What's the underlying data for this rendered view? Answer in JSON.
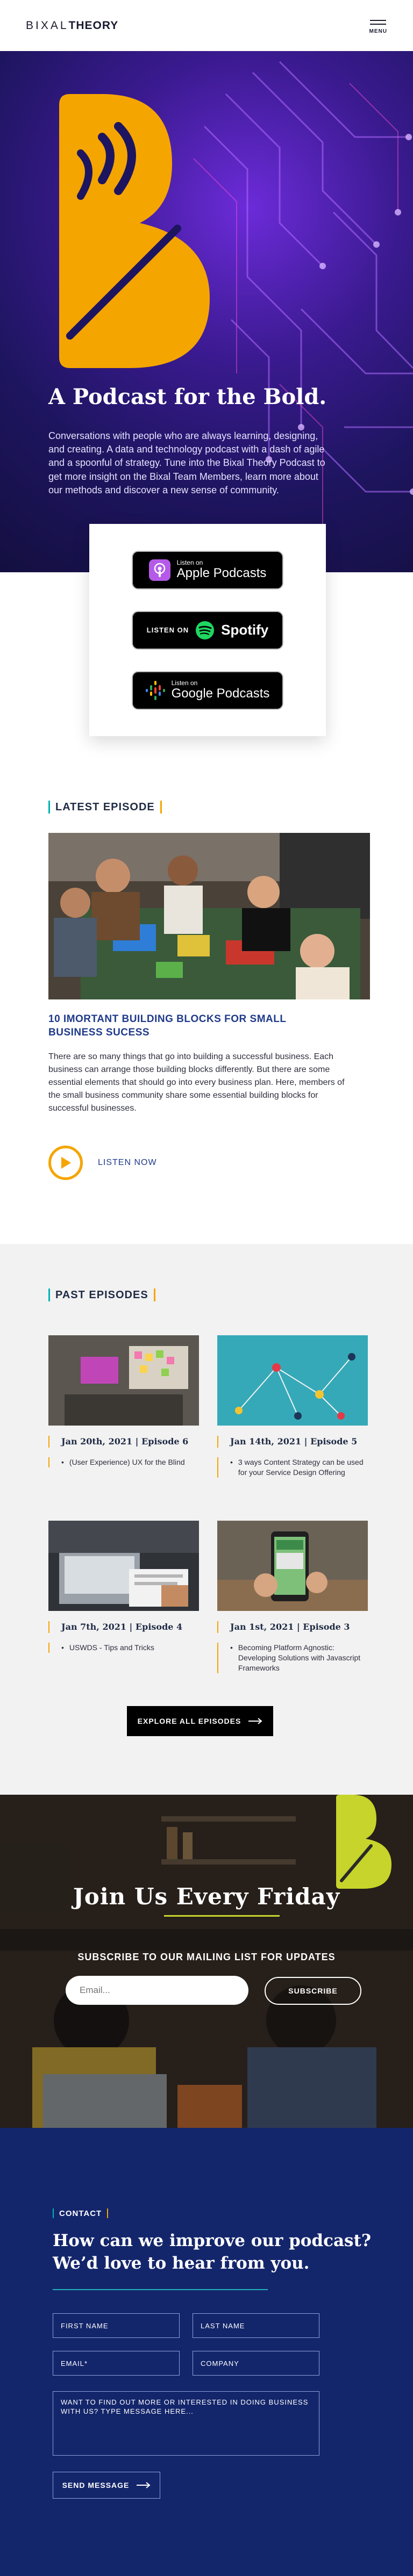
{
  "header": {
    "logo_light": "BIXAL",
    "logo_bold": "THEORY",
    "menu_label": "MENU"
  },
  "hero": {
    "title": "A Podcast for the Bold.",
    "text": "Conversations with people who are always learning, designing, and creating. A data and technology podcast with a dash of agile and a spoonful of strategy. Tune into the Bixal Theory Podcast to get more insight on the Bixal Team Members, learn more about our methods and discover a new sense of community."
  },
  "platforms": {
    "apple": {
      "small": "Listen on",
      "big": "Apple Podcasts"
    },
    "spotify": {
      "small": "LISTEN ON",
      "big": "Spotify"
    },
    "google": {
      "small": "Listen on",
      "big": "Google Podcasts"
    }
  },
  "latest": {
    "heading": "LATEST EPISODE",
    "title": "10 IMORTANT BUILDING BLOCKS FOR SMALL BUSINESS SUCESS",
    "description": "There are so many things that go into building a successful business. Each business can arrange those building blocks differently. But there are some essential elements that should go into every business plan. Here, members of the small business community share some essential building blocks for successful businesses.",
    "listen_label": "LISTEN NOW"
  },
  "past": {
    "heading": "PAST EPISODES",
    "episodes": [
      {
        "date": "Jan 20th, 2021 | Episode 6",
        "title": "(User Experience) UX for the Blind"
      },
      {
        "date": "Jan 14th, 2021 | Episode 5",
        "title": "3 ways Content Strategy can be used for your Service Design Offering"
      },
      {
        "date": "Jan 7th, 2021 | Episode 4",
        "title": "USWDS - Tips and Tricks"
      },
      {
        "date": "Jan 1st, 2021 | Episode 3",
        "title": "Becoming Platform Agnostic: Developing Solutions with Javascript Frameworks"
      }
    ],
    "explore_label": "EXPLORE ALL EPISODES"
  },
  "join": {
    "title": "Join Us Every Friday",
    "subtitle": "SUBSCRIBE TO OUR MAILING LIST FOR UPDATES",
    "email_placeholder": "Email...",
    "subscribe_label": "SUBSCRIBE"
  },
  "contact": {
    "label": "CONTACT",
    "title": "How can we improve our podcast? We’d love to hear from you.",
    "first_name": "FIRST NAME",
    "last_name": "LAST NAME",
    "email": "EMAIL*",
    "company": "COMPANY",
    "message": "WANT TO FIND OUT MORE OR INTERESTED IN DOING BUSINESS WITH US? TYPE MESSAGE HERE...",
    "send_label": "SEND MESSAGE"
  },
  "colors": {
    "accent_orange": "#F5A500",
    "navy": "#14266B",
    "teal": "#00B3B3",
    "lime": "#C7D42B"
  }
}
